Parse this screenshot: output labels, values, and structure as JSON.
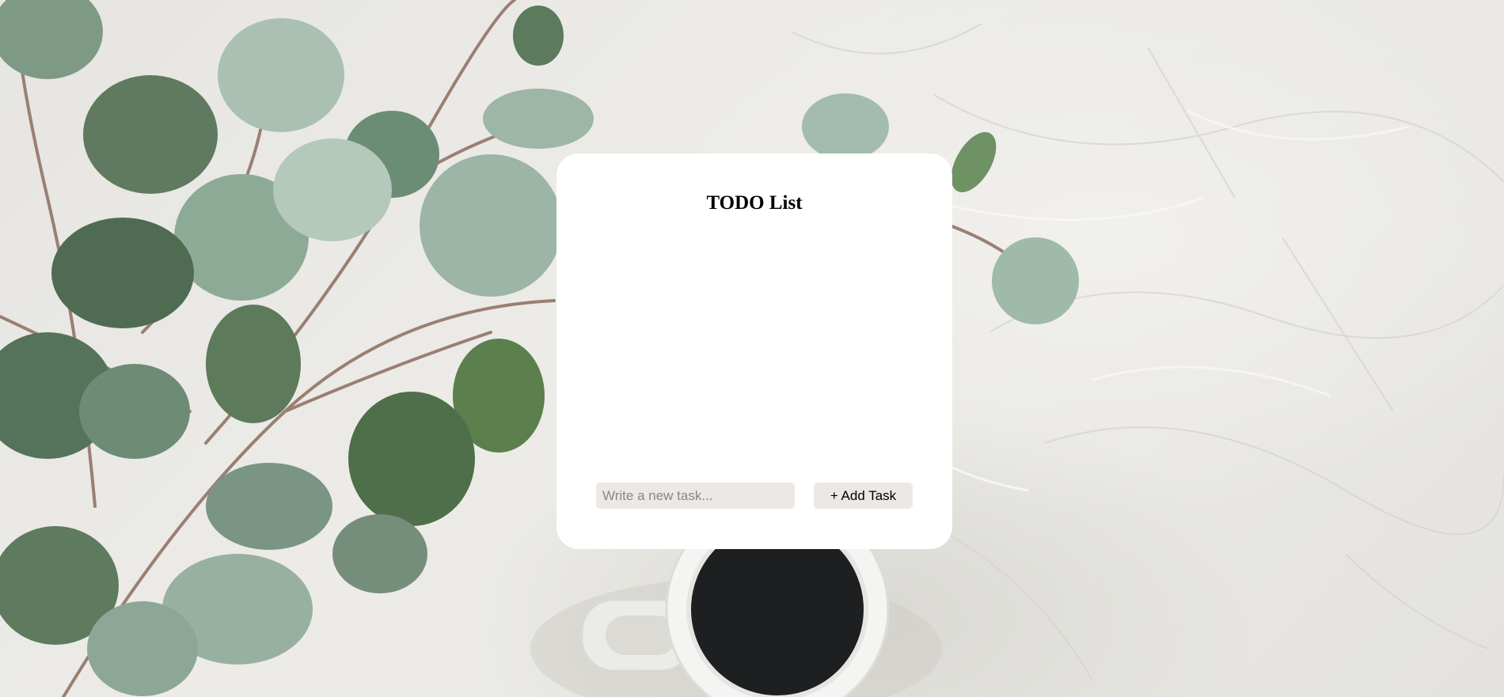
{
  "app": {
    "title": "TODO List"
  },
  "task_input": {
    "value": "",
    "placeholder": "Write a new task..."
  },
  "add_button": {
    "label": "+ Add Task"
  },
  "tasks": [],
  "colors": {
    "card": "#ffffff",
    "control_bg": "#ece8e6",
    "page_bg": "#e8e7e3",
    "leaf_dark": "#5f7a5f",
    "leaf_light": "#9fb7a8",
    "coffee": "#1e1f21",
    "mug": "#f4f4f2"
  }
}
